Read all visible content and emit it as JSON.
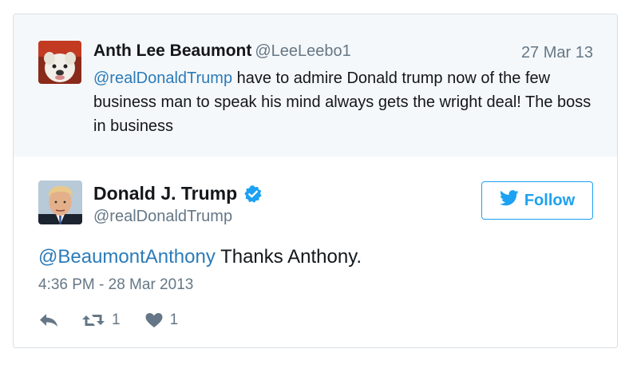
{
  "reply_tweet": {
    "author_name": "Anth Lee Beaumont",
    "author_handle": "@LeeLeebo1",
    "date": "27 Mar 13",
    "mention": "@realDonaldTrump",
    "text": " have to admire Donald trump now of the few business man to speak his mind always gets the wright deal! The boss in business"
  },
  "main_tweet": {
    "author_name": "Donald J. Trump",
    "author_handle": "@realDonaldTrump",
    "verified": true,
    "follow_label": "Follow",
    "mention": "@BeaumontAnthony",
    "text": " Thanks Anthony.",
    "timestamp": "4:36 PM - 28 Mar 2013",
    "retweet_count": "1",
    "like_count": "1"
  },
  "icons": {
    "reply": "reply-icon",
    "retweet": "retweet-icon",
    "like": "heart-icon",
    "verified": "verified-badge-icon",
    "follow": "twitter-bird-icon"
  },
  "colors": {
    "link": "#2b7bb9",
    "accent": "#1da1f2",
    "muted": "#657786",
    "reply_background": "#f5f8fa"
  }
}
